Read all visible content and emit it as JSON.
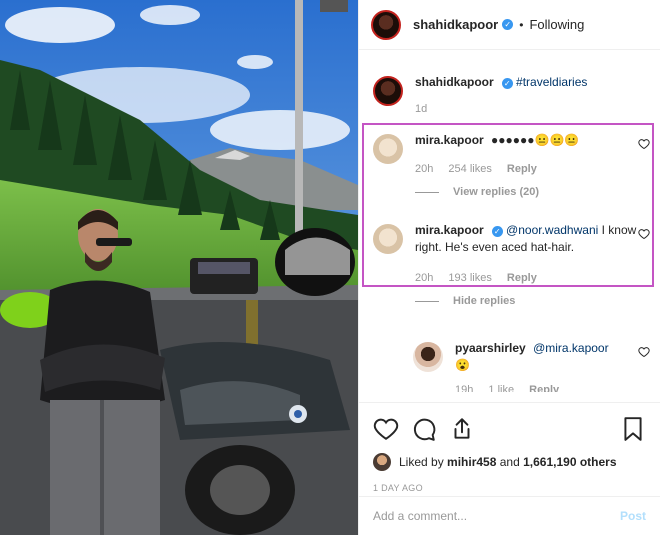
{
  "header": {
    "username": "shahidkapoor",
    "follow_status": "Following",
    "verified_icon": "verified-badge-icon"
  },
  "caption": {
    "username": "shahidkapoor",
    "hashtag": "#traveldiaries",
    "age": "1d"
  },
  "comments": [
    {
      "username": "mira.kapoor",
      "text": "●●●●●●😐😐😐",
      "age": "20h",
      "likes": "254 likes",
      "reply_label": "Reply",
      "thread_toggle": "View replies (20)"
    },
    {
      "username": "mira.kapoor",
      "mention": "@noor.wadhwani",
      "text": "I know right. He's even aced hat-hair.",
      "age": "20h",
      "likes": "193 likes",
      "reply_label": "Reply",
      "thread_toggle": "Hide replies"
    },
    {
      "username": "pyaarshirley",
      "mention": "@mira.kapoor",
      "text": "😮",
      "age": "19h",
      "likes": "1 like",
      "reply_label": "Reply"
    }
  ],
  "actions": {
    "icons": [
      "heart-icon",
      "comment-icon",
      "share-icon",
      "bookmark-icon"
    ]
  },
  "likes": {
    "prefix": "Liked by",
    "user": "mihir458",
    "joiner": "and",
    "count": "1,661,190 others"
  },
  "timestamp": "1 DAY AGO",
  "add_comment": {
    "placeholder": "Add a comment...",
    "post_label": "Post"
  },
  "colors": {
    "verified": "#3897f0",
    "highlight_border": "#c455c4",
    "post_button": "#b2dffc",
    "mention": "#003569"
  }
}
